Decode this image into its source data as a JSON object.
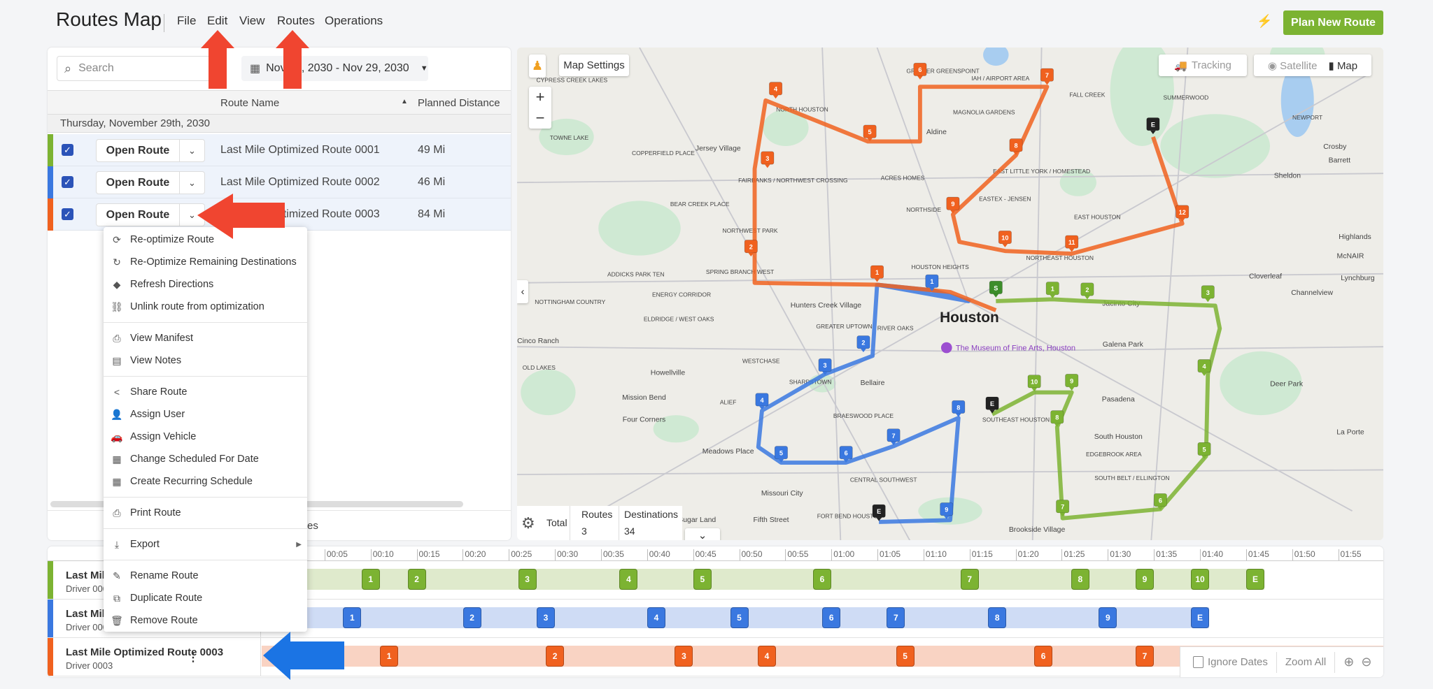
{
  "header": {
    "title": "Routes Map",
    "menu": [
      "File",
      "Edit",
      "View",
      "Routes",
      "Operations"
    ],
    "plan_button": "Plan New Route",
    "bolt_icon": "lightning-icon"
  },
  "colors": {
    "green": "#7cb332",
    "blue": "#3a78e0",
    "orange": "#f0611f",
    "end": "#222222",
    "accent": "#7cb332",
    "arrow_red": "#f04530",
    "arrow_blue": "#1b74e4"
  },
  "left_panel": {
    "search_placeholder": "Search",
    "date_range": "Nov 29, 2030 - Nov 29, 2030",
    "columns": {
      "route_name": "Route Name",
      "planned_distance": "Planned Distance"
    },
    "group_date": "Thursday, November 29th, 2030",
    "rows": [
      {
        "color": "green",
        "open_label": "Open Route",
        "name": "Last Mile Optimized Route 0001",
        "distance": "49 Mi",
        "checked": true
      },
      {
        "color": "blue",
        "open_label": "Open Route",
        "name": "Last Mile Optimized Route 0002",
        "distance": "46 Mi",
        "checked": true
      },
      {
        "color": "orange",
        "open_label": "Open Route",
        "name": "Last Mile Optimized Route 0003",
        "distance": "84 Mi",
        "checked": true
      }
    ],
    "footer_fragment": "es"
  },
  "context_menu": {
    "groups": [
      [
        {
          "label": "Re-optimize Route",
          "icon": "sync-icon",
          "glyph": "⟳"
        },
        {
          "label": "Re-Optimize Remaining Destinations",
          "icon": "refresh-icon",
          "glyph": "↻"
        },
        {
          "label": "Refresh Directions",
          "icon": "directions-icon",
          "glyph": "◆"
        },
        {
          "label": "Unlink route from optimization",
          "icon": "unlink-icon",
          "glyph": "⛓"
        }
      ],
      [
        {
          "label": "View Manifest",
          "icon": "print-icon",
          "glyph": "⎙"
        },
        {
          "label": "View Notes",
          "icon": "note-icon",
          "glyph": "▤"
        }
      ],
      [
        {
          "label": "Share Route",
          "icon": "share-icon",
          "glyph": "<"
        },
        {
          "label": "Assign User",
          "icon": "user-icon",
          "glyph": "👤"
        },
        {
          "label": "Assign Vehicle",
          "icon": "car-icon",
          "glyph": "🚗"
        },
        {
          "label": "Change Scheduled For Date",
          "icon": "calendar-icon",
          "glyph": "▦"
        },
        {
          "label": "Create Recurring Schedule",
          "icon": "calendar-icon",
          "glyph": "▦"
        }
      ],
      [
        {
          "label": "Print Route",
          "icon": "print-icon",
          "glyph": "⎙"
        }
      ],
      [
        {
          "label": "Export",
          "icon": "download-icon",
          "glyph": "⤓",
          "submenu": true
        }
      ],
      [
        {
          "label": "Rename Route",
          "icon": "pencil-icon",
          "glyph": "✎"
        },
        {
          "label": "Duplicate Route",
          "icon": "duplicate-icon",
          "glyph": "⧉"
        },
        {
          "label": "Remove Route",
          "icon": "trash-icon",
          "glyph": "🗑"
        }
      ]
    ]
  },
  "map": {
    "map_settings": "Map Settings",
    "tracking": "Tracking",
    "satellite": "Satellite",
    "map_type": "Map",
    "stats": {
      "total": "Total",
      "routes_label": "Routes",
      "destinations_label": "Destinations",
      "routes": "3",
      "destinations": "34"
    },
    "city": "Houston",
    "poi": "The Museum of Fine Arts, Houston",
    "places": [
      "CYPRESS CREEK LAKES",
      "TOWNE LAKE",
      "COPPERFIELD PLACE",
      "Jersey Village",
      "NORTH HOUSTON",
      "Aldine",
      "GREATER GREENSPOINT",
      "IAH / AIRPORT AREA",
      "MAGNOLIA GARDENS",
      "FALL CREEK",
      "SUMMERWOOD",
      "NEWPORT",
      "Crosby",
      "Barrett",
      "Sheldon",
      "EAST LITTLE YORK / HOMESTEAD",
      "ACRES HOMES",
      "BEAR CREEK PLACE",
      "FAIRBANKS / NORTHWEST CROSSING",
      "NORTHSIDE",
      "EASTEX - JENSEN",
      "EAST HOUSTON",
      "NORTHWEST PARK",
      "SPRING BRANCH WEST",
      "ADDICKS PARK TEN",
      "NOTTINGHAM COUNTRY",
      "ENERGY CORRIDOR",
      "ELDRIDGE / WEST OAKS",
      "Hunters Creek Village",
      "HOUSTON HEIGHTS",
      "GREATER UPTOWN",
      "RIVER OAKS",
      "NORTHEAST HOUSTON",
      "Cloverleaf",
      "Channelview",
      "Lynchburg",
      "McNAIR",
      "Highlands",
      "Jacinto City",
      "Galena Park",
      "Cinco Ranch",
      "OLD LAKES",
      "Howellville",
      "WESTCHASE",
      "SHARPSTOWN",
      "Bellaire",
      "Pasadena",
      "Deer Park",
      "ALIEF",
      "Mission Bend",
      "Four Corners",
      "BRAESWOOD PLACE",
      "Meadows Place",
      "SOUTHEAST HOUSTON",
      "South Houston",
      "EDGEBROOK AREA",
      "La Porte",
      "CENTRAL SOUTHWEST",
      "Missouri City",
      "Fifth Street",
      "FORT BEND HOUSTON",
      "Brookside Village",
      "SOUTH BELT / ELLINGTON",
      "Sugar Land"
    ],
    "routes": [
      {
        "color": "green",
        "stops": [
          "S",
          "1",
          "2",
          "3",
          "4",
          "5",
          "6",
          "7",
          "8",
          "9",
          "10",
          "E"
        ]
      },
      {
        "color": "blue",
        "stops": [
          "1",
          "2",
          "3",
          "4",
          "5",
          "6",
          "7",
          "8",
          "9",
          "E"
        ]
      },
      {
        "color": "orange",
        "stops": [
          "1",
          "2",
          "3",
          "4",
          "5",
          "6",
          "7",
          "8",
          "9",
          "10",
          "11",
          "12",
          "E"
        ]
      }
    ]
  },
  "timeline": {
    "ticks": [
      "00:05",
      "00:10",
      "00:15",
      "00:20",
      "00:25",
      "00:30",
      "00:35",
      "00:40",
      "00:45",
      "00:50",
      "00:55",
      "01:00",
      "01:05",
      "01:10",
      "01:15",
      "01:20",
      "01:25",
      "01:30",
      "01:35",
      "01:40",
      "01:45",
      "01:50",
      "01:55"
    ],
    "rows": [
      {
        "color": "green",
        "name": "Last Mile Optimized Route 0001",
        "driver": "Driver 0001",
        "stops": [
          [
            "1",
            "00:10"
          ],
          [
            "2",
            "00:15"
          ],
          [
            "3",
            "00:27"
          ],
          [
            "4",
            "00:38"
          ],
          [
            "5",
            "00:46"
          ],
          [
            "6",
            "00:59"
          ],
          [
            "7",
            "01:15"
          ],
          [
            "8",
            "01:27"
          ],
          [
            "9",
            "01:34"
          ],
          [
            "10",
            "01:40"
          ],
          [
            "E",
            "01:46"
          ]
        ]
      },
      {
        "color": "blue",
        "name": "Last Mile Optimized Route 0002",
        "driver": "Driver 0002",
        "stops": [
          [
            "1",
            "00:08"
          ],
          [
            "2",
            "00:21"
          ],
          [
            "3",
            "00:29"
          ],
          [
            "4",
            "00:41"
          ],
          [
            "5",
            "00:50"
          ],
          [
            "6",
            "01:00"
          ],
          [
            "7",
            "01:07"
          ],
          [
            "8",
            "01:18"
          ],
          [
            "9",
            "01:30"
          ],
          [
            "E",
            "01:40"
          ]
        ]
      },
      {
        "color": "orange",
        "name": "Last Mile Optimized Route 0003",
        "driver": "Driver 0003",
        "stops": [
          [
            "1",
            "00:12"
          ],
          [
            "2",
            "00:30"
          ],
          [
            "3",
            "00:44"
          ],
          [
            "4",
            "00:53"
          ],
          [
            "5",
            "01:08"
          ],
          [
            "6",
            "01:23"
          ],
          [
            "7",
            "01:34"
          ]
        ]
      }
    ],
    "ignore_dates": "Ignore Dates",
    "zoom_all": "Zoom All"
  }
}
